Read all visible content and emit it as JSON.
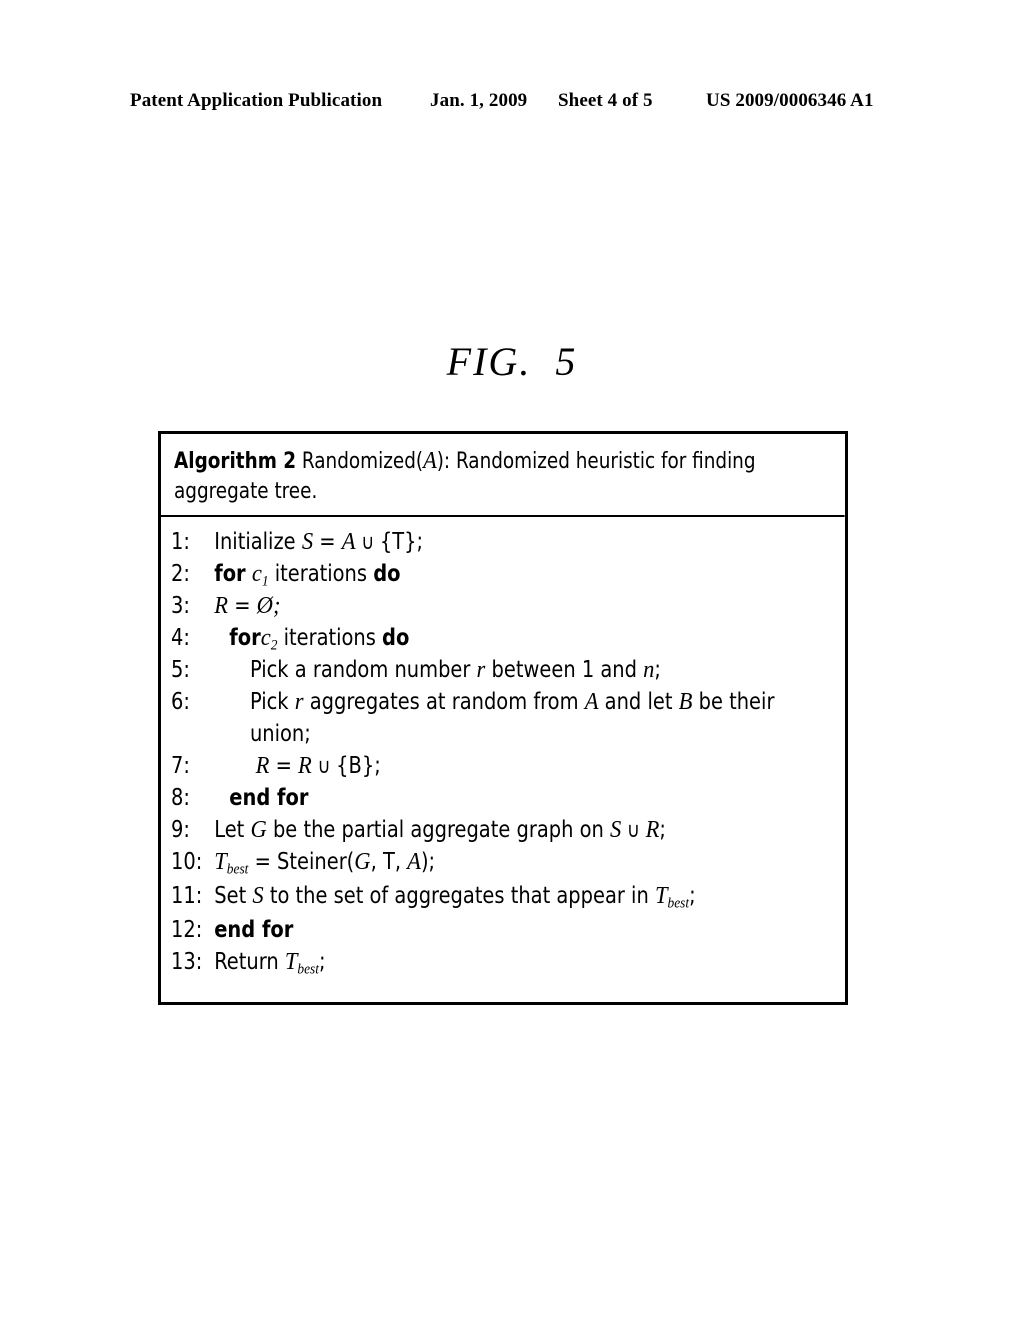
{
  "header": {
    "publication": "Patent Application Publication",
    "date": "Jan. 1, 2009",
    "sheet": "Sheet 4 of 5",
    "patent_number": "US 2009/0006346 A1"
  },
  "figure": {
    "label": "FIG.  5"
  },
  "algorithm": {
    "caption_keyword": "Algorithm 2",
    "caption_rest": " Randomized(A): Randomized heuristic for finding aggregate tree.",
    "caption_full": "Algorithm 2 Randomized(A): Randomized heuristic for finding aggregate tree.",
    "lines": [
      {
        "n": "1:",
        "text": "Initialize S = A ∪ {T};"
      },
      {
        "n": "2:",
        "text": "for c1 iterations do"
      },
      {
        "n": "3:",
        "text": "R = Ø;"
      },
      {
        "n": "4:",
        "text": "for c2 iterations do"
      },
      {
        "n": "5:",
        "text": "Pick a random number r between 1 and n;"
      },
      {
        "n": "6:",
        "text": "Pick r aggregates at random from A and let B be their"
      },
      {
        "n": "",
        "text": "union;"
      },
      {
        "n": "7:",
        "text": "R = R ∪ {B};"
      },
      {
        "n": "8:",
        "text": "end for"
      },
      {
        "n": "9:",
        "text": "Let G be the partial aggregate graph on S ∪ R;"
      },
      {
        "n": "10:",
        "text": "Tbest = Steiner(G, T, A);"
      },
      {
        "n": "11:",
        "text": "Set S to the set of aggregates that appear in Tbest;"
      },
      {
        "n": "12:",
        "text": "end for"
      },
      {
        "n": "13:",
        "text": "Return Tbest;"
      }
    ],
    "line_numbers": {
      "n1": "1:",
      "n2": "2:",
      "n3": "3:",
      "n4": "4:",
      "n5": "5:",
      "n6": "6:",
      "n6b": "",
      "n7": "7:",
      "n8": "8:",
      "n9": "9:",
      "n10": "10:",
      "n11": "11:",
      "n12": "12:",
      "n13": "13:"
    },
    "tokens": {
      "initialize": "Initialize",
      "eq": " = ",
      "union_op": " ∪ ",
      "brace_T": "{T};",
      "for": "for",
      "c_letter": "c",
      "sub1": "1",
      "sub2": "2",
      "iterations": " iterations ",
      "do": "do",
      "R": "R",
      "emptyset": "Ø;",
      "pick_a_random_number": "Pick a random number ",
      "r": "r",
      "between": " between 1 and ",
      "n_var": "n",
      "semi": ";",
      "pick": "Pick ",
      "aggregates_at_random_from": " aggregates at random from ",
      "A": "A",
      "and_let": " and let ",
      "B": "B",
      "be_their": " be their",
      "union_word": "union;",
      "brace_B": "{B};",
      "end_for": "end for",
      "let": "Let ",
      "G": "G",
      "partial_graph": " be the partial aggregate graph on ",
      "S": "S",
      "T_italic": "T",
      "best_sub": "best",
      "eq_steiner": " = Steiner(",
      "comma_T": ", T, ",
      "close_paren": ");",
      "set": "Set ",
      "to_the_set": " to the set of aggregates that appear in ",
      "return": "Return "
    }
  }
}
